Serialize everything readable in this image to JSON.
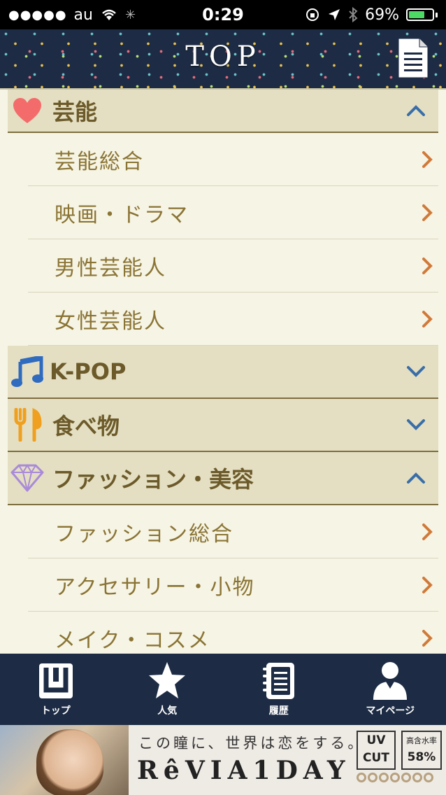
{
  "status_bar": {
    "carrier": "au",
    "time": "0:29",
    "battery": "69%",
    "battery_level": 0.69
  },
  "header": {
    "title": "TOP"
  },
  "categories": [
    {
      "label": "芸能",
      "icon": "heart-icon",
      "expanded": true,
      "items": [
        "芸能総合",
        "映画・ドラマ",
        "男性芸能人",
        "女性芸能人"
      ]
    },
    {
      "label": "K-POP",
      "icon": "music-note-icon",
      "expanded": false,
      "items": []
    },
    {
      "label": "食べ物",
      "icon": "fork-knife-icon",
      "expanded": false,
      "items": []
    },
    {
      "label": "ファッション・美容",
      "icon": "diamond-icon",
      "expanded": true,
      "items": [
        "ファッション総合",
        "アクセサリー・小物",
        "メイク・コスメ"
      ]
    }
  ],
  "tabs": [
    {
      "label": "トップ",
      "icon": "top-icon"
    },
    {
      "label": "人気",
      "icon": "star-icon"
    },
    {
      "label": "履歴",
      "icon": "notebook-icon"
    },
    {
      "label": "マイページ",
      "icon": "user-icon"
    }
  ],
  "ad": {
    "tagline": "この瞳に、世界は恋をする。",
    "brand": "RêVIA1DAY",
    "uv_line1": "UV",
    "uv_line2": "CUT",
    "rate_label": "高含水率",
    "rate_value": "58%"
  },
  "colors": {
    "header_bg": "#1d2c44",
    "category_bg": "#e4dfc2",
    "item_text": "#8a7435",
    "chevron": "#d07a3a",
    "expand_chevron": "#3a6ea8"
  }
}
